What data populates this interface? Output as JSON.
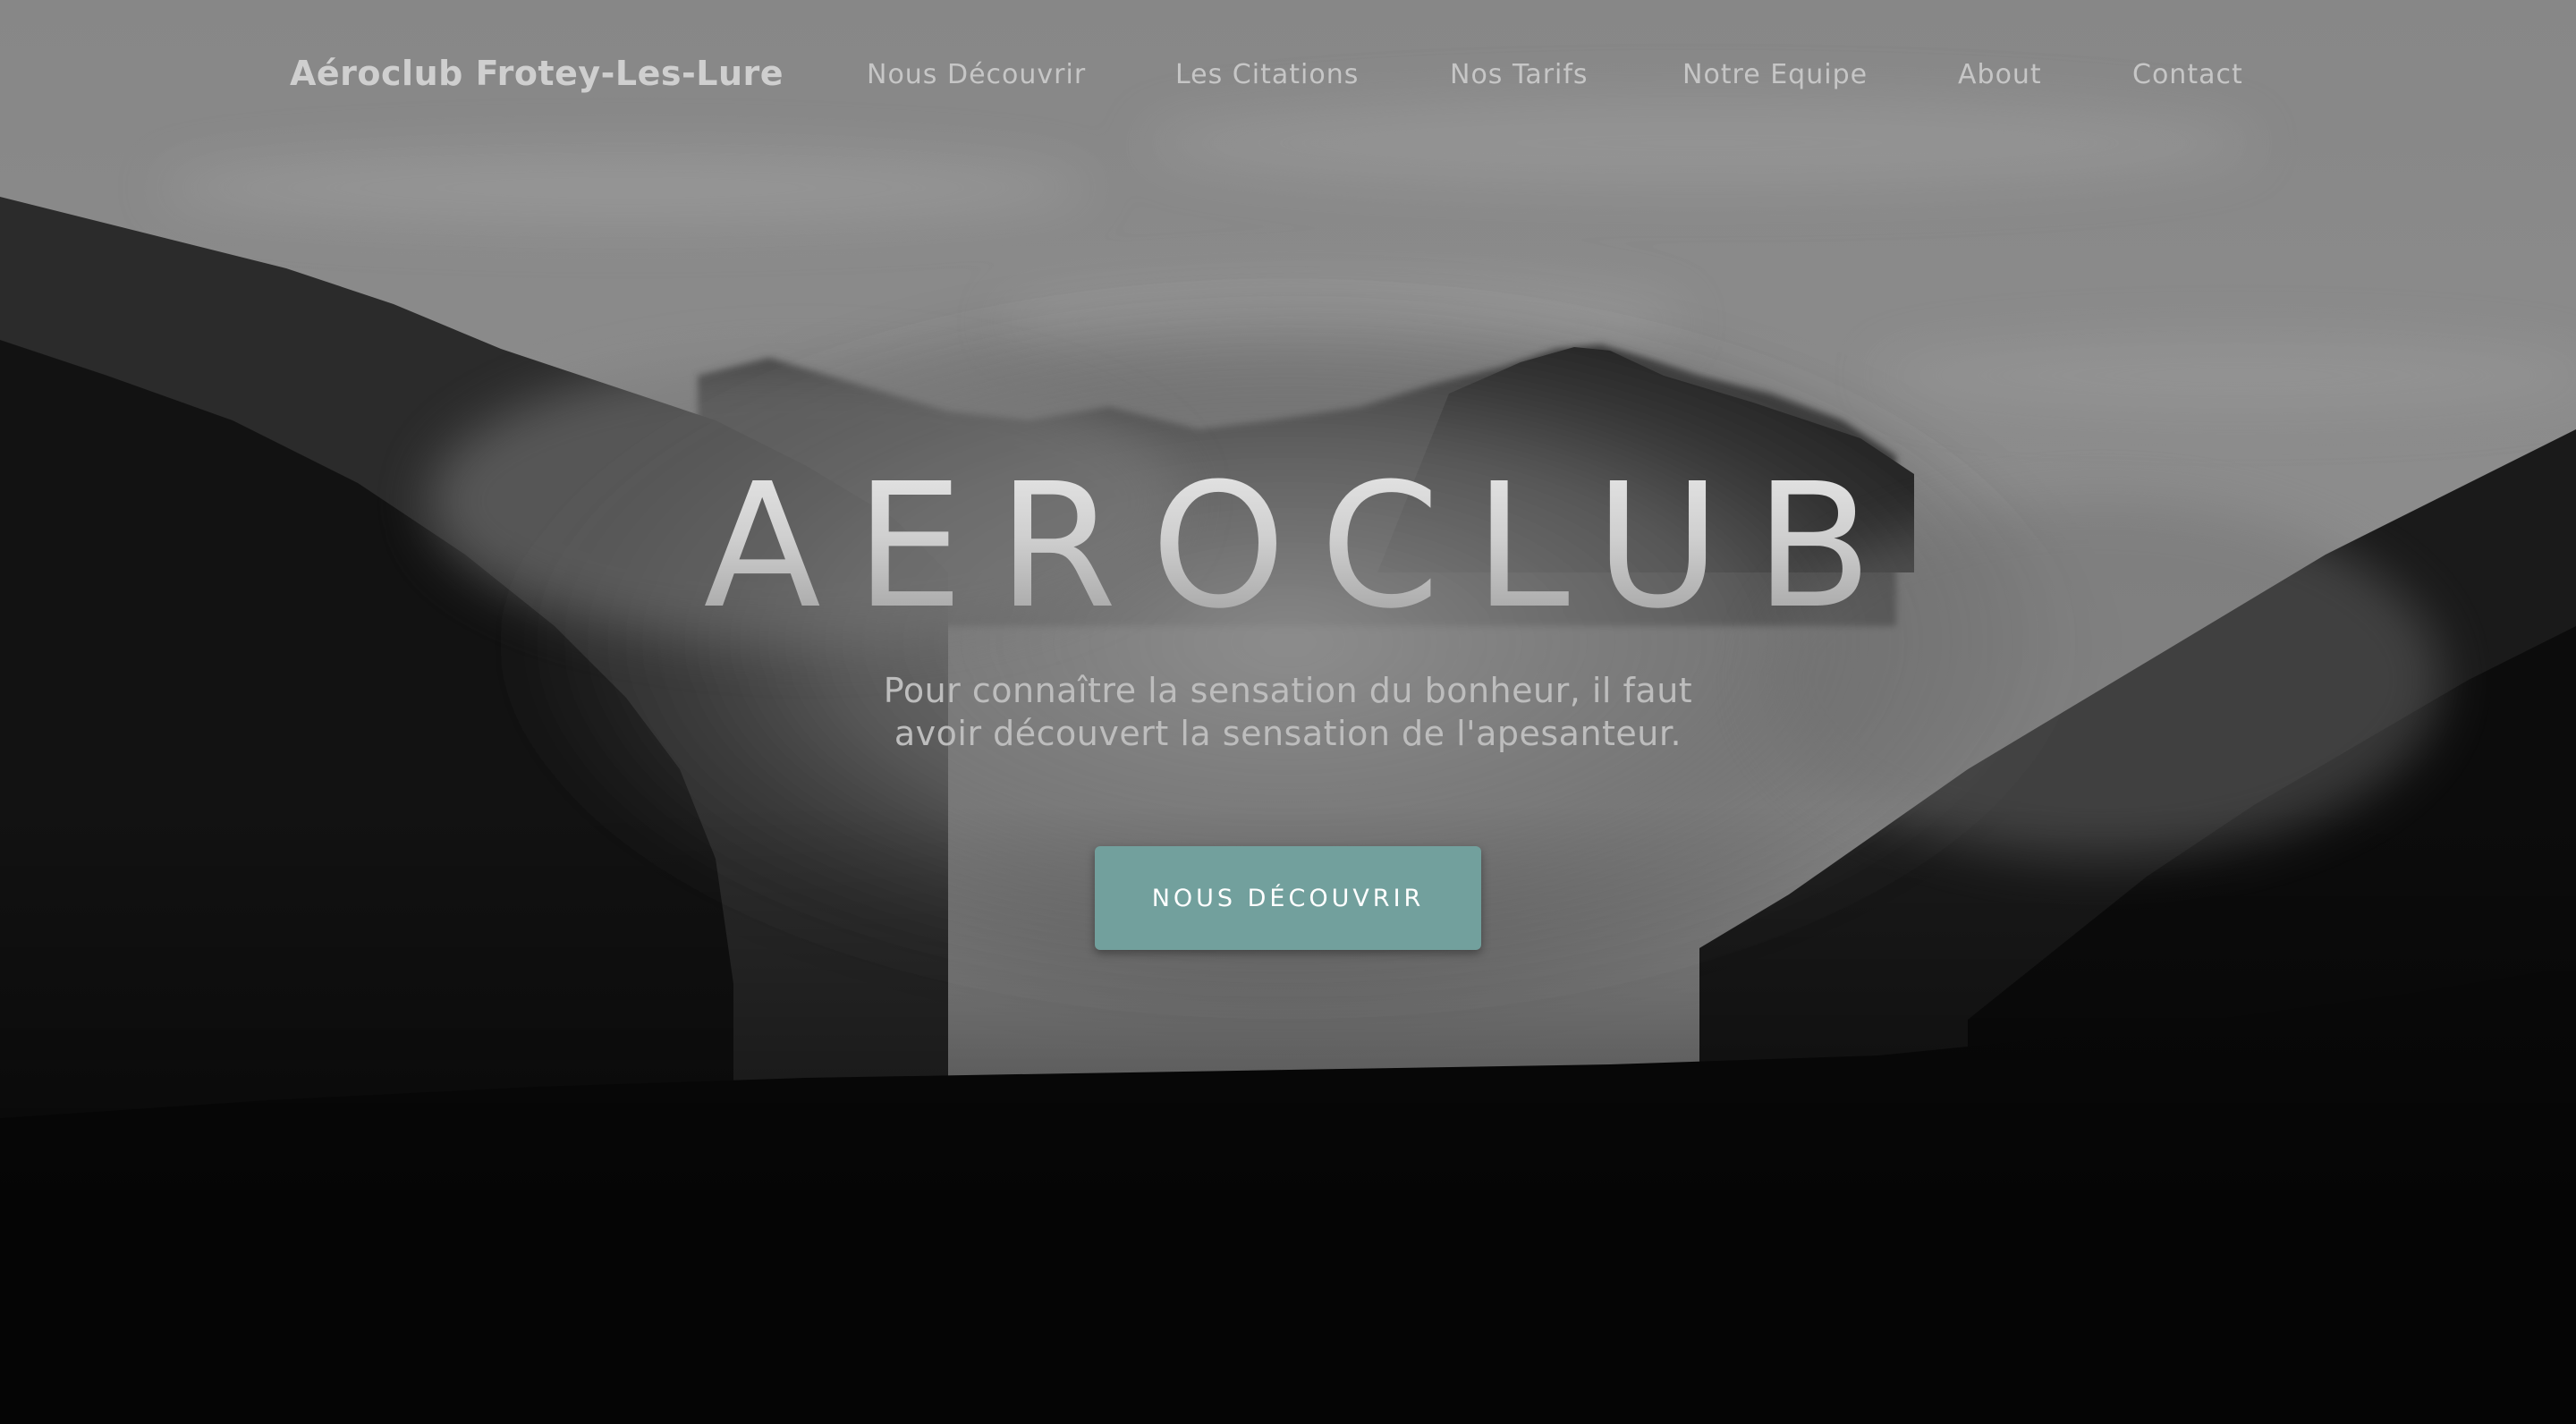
{
  "navbar": {
    "brand": "Aéroclub Frotey-Les-Lure",
    "items": [
      {
        "label": "Nous Découvrir"
      },
      {
        "label": "Les Citations"
      },
      {
        "label": "Nos Tarifs"
      },
      {
        "label": "Notre Equipe"
      },
      {
        "label": "About"
      },
      {
        "label": "Contact"
      }
    ]
  },
  "hero": {
    "title": "AEROCLUB",
    "subtitle_line1": "Pour connaître la sensation du bonheur, il faut",
    "subtitle_line2": "avoir découvert la sensation de l'apesanteur.",
    "button_label": "NOUS DÉCOUVRIR"
  },
  "colors": {
    "accent": "#72a09d",
    "nav_text": "#c6c6c6",
    "brand_text": "#cfcfcf"
  }
}
